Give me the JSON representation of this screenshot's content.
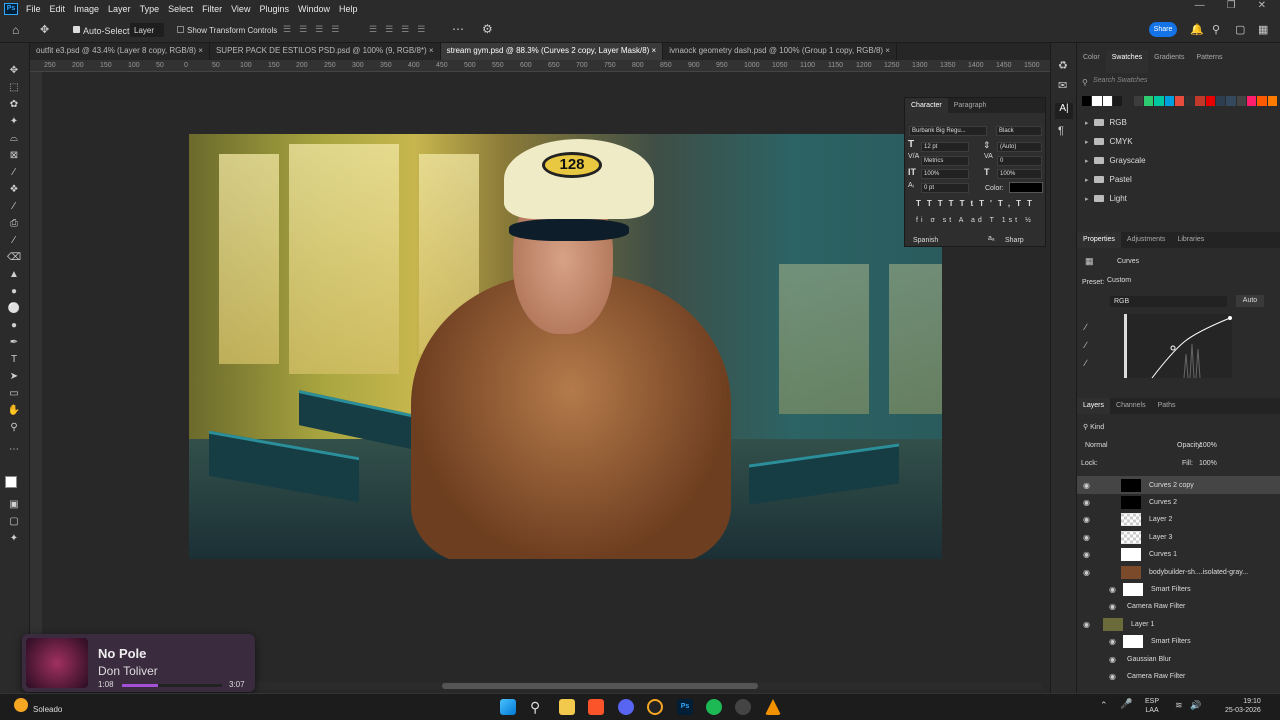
{
  "menu": {
    "items": [
      "File",
      "Edit",
      "Image",
      "Layer",
      "Type",
      "Select",
      "Filter",
      "View",
      "Plugins",
      "Window",
      "Help"
    ]
  },
  "options": {
    "auto_select": "Auto-Select:",
    "layer_dropdown": "Layer",
    "show_transform": "Show Transform Controls",
    "share": "Share"
  },
  "tabs": [
    {
      "label": "outfit e3.psd @ 43.4% (Layer 8 copy, RGB/8)",
      "active": false
    },
    {
      "label": "SUPER PACK DE ESTILOS PSD.psd @ 100% (9, RGB/8*)",
      "active": false
    },
    {
      "label": "stream gym.psd @ 88.3% (Curves 2 copy, Layer Mask/8)",
      "active": true
    },
    {
      "label": "ivnaock geometry dash.psd @ 100% (Group 1 copy, RGB/8)",
      "active": false
    }
  ],
  "ruler": {
    "ticks": [
      "250",
      "200",
      "150",
      "100",
      "50",
      "0",
      "50",
      "100",
      "150",
      "200",
      "250",
      "300",
      "350",
      "400",
      "450",
      "500",
      "550",
      "600",
      "650",
      "700",
      "750",
      "800",
      "850",
      "900",
      "950",
      "1000",
      "1050",
      "1100",
      "1150",
      "1200",
      "1250",
      "1300",
      "1350",
      "1400",
      "1450",
      "1500"
    ]
  },
  "hat_text": "128",
  "swatches_panel": {
    "tabs": [
      "Color",
      "Swatches",
      "Gradients",
      "Patterns"
    ],
    "active_tab": "Swatches",
    "search_placeholder": "Search Swatches",
    "colors": [
      "#000000",
      "#ffffff",
      "#ffffff",
      "#1a1a1a",
      "#2b2b2b",
      "#3d3d3d",
      "#2ecc71",
      "#00c8a0",
      "#00a0e0",
      "#e74c3c",
      "#303030",
      "#c0392b",
      "#e60000",
      "#2c3e50",
      "#34495e",
      "#444",
      "#ff1e6e",
      "#ff5a00",
      "#ff7b00"
    ],
    "folders": [
      "RGB",
      "CMYK",
      "Grayscale",
      "Pastel",
      "Light"
    ]
  },
  "character_panel": {
    "tabs": [
      "Character",
      "Paragraph"
    ],
    "font": "Burbank Big Regu...",
    "style": "Black",
    "size": "12 pt",
    "leading": "(Auto)",
    "kerning": "Metrics",
    "tracking": "0",
    "vscale": "100%",
    "hscale": "100%",
    "baseline": "0 pt",
    "color_label": "Color:",
    "language": "Spanish",
    "aa_label": "aₐ",
    "antialias": "Sharp",
    "style_buttons": [
      "T",
      "T",
      "TT",
      "Tt",
      "T'",
      "T,",
      "T",
      "T"
    ],
    "ot_buttons": [
      "fi",
      "σ",
      "st",
      "A",
      "ad",
      "T",
      "1st",
      "½"
    ]
  },
  "properties_panel": {
    "tabs": [
      "Properties",
      "Adjustments",
      "Libraries"
    ],
    "title": "Curves",
    "preset_label": "Preset:",
    "preset_value": "Custom",
    "channel": "RGB",
    "auto": "Auto"
  },
  "layers_panel": {
    "tabs": [
      "Layers",
      "Channels",
      "Paths"
    ],
    "filter": "Kind",
    "blend": "Normal",
    "opacity_label": "Opacity:",
    "opacity": "100%",
    "lock_label": "Lock:",
    "fill_label": "Fill:",
    "fill": "100%",
    "layers": [
      {
        "name": "Curves 2 copy",
        "thumb": "black",
        "selected": true,
        "indent": false
      },
      {
        "name": "Curves 2",
        "thumb": "black",
        "selected": false,
        "indent": false
      },
      {
        "name": "Layer 2",
        "thumb": "check",
        "selected": false,
        "indent": false
      },
      {
        "name": "Layer 3",
        "thumb": "check",
        "selected": false,
        "indent": false
      },
      {
        "name": "Curves 1",
        "thumb": "white",
        "selected": false,
        "indent": false
      },
      {
        "name": "bodybuilder-sh....isolated-gray...",
        "thumb": "photo",
        "selected": false,
        "indent": false
      },
      {
        "name": "Smart Filters",
        "thumb": "white",
        "selected": false,
        "indent": true
      },
      {
        "name": "Camera Raw Filter",
        "thumb": "none",
        "selected": false,
        "indent": true
      },
      {
        "name": "Layer 1",
        "thumb": "photo2",
        "selected": false,
        "indent": false
      },
      {
        "name": "Smart Filters",
        "thumb": "white",
        "selected": false,
        "indent": true
      },
      {
        "name": "Gaussian Blur",
        "thumb": "none",
        "selected": false,
        "indent": true
      },
      {
        "name": "Camera Raw Filter",
        "thumb": "none",
        "selected": false,
        "indent": true
      }
    ]
  },
  "media": {
    "title": "No Pole",
    "artist": "Don Toliver",
    "elapsed": "1:08",
    "duration": "3:07",
    "progress": 0.36
  },
  "taskbar": {
    "weather": "Soleado",
    "lang1": "ESP",
    "lang2": "LAA",
    "time": "19:10",
    "date": "25-03-2026"
  }
}
